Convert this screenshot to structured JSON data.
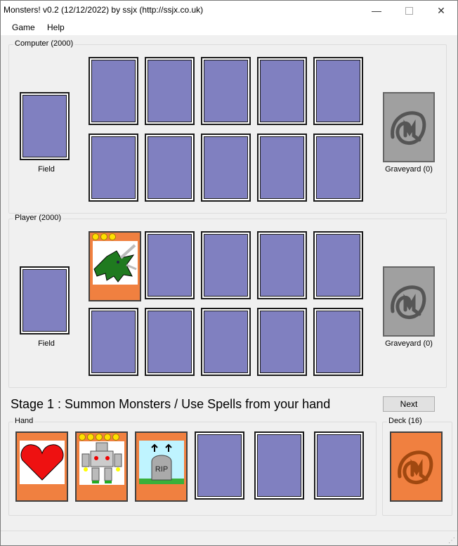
{
  "window": {
    "title": "Monsters! v0.2 (12/12/2022) by ssjx (http://ssjx.co.uk)"
  },
  "menu": {
    "game": "Game",
    "help": "Help"
  },
  "computer": {
    "label": "Computer (2000)",
    "field": "Field",
    "graveyard": "Graveyard (0)"
  },
  "player": {
    "label": "Player (2000)",
    "field": "Field",
    "graveyard": "Graveyard (0)"
  },
  "stage": {
    "text": "Stage 1 : Summon Monsters / Use Spells from your hand"
  },
  "buttons": {
    "next": "Next"
  },
  "hand": {
    "label": "Hand"
  },
  "deck": {
    "label": "Deck (16)"
  },
  "icons": {
    "close": "close-icon",
    "minimize": "minimize-icon",
    "maximize": "maximize-icon",
    "graveyard": "swirl-m-icon",
    "deck": "swirl-m-icon"
  },
  "colors": {
    "card_back": "#8080c0",
    "orange": "#f08040",
    "graveyard": "#a0a0a0"
  }
}
